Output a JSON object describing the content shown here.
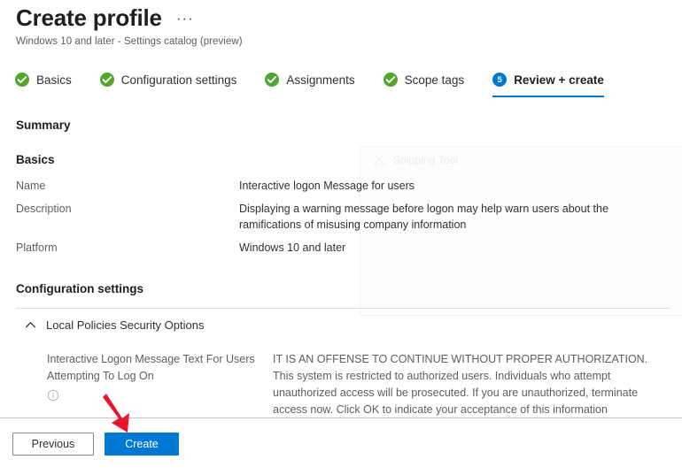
{
  "header": {
    "title": "Create profile",
    "more_menu": "···",
    "subtitle": "Windows 10 and later - Settings catalog (preview)"
  },
  "wizard": {
    "tabs": [
      {
        "label": "Basics",
        "state": "done",
        "badge": "✓"
      },
      {
        "label": "Configuration settings",
        "state": "done",
        "badge": "✓"
      },
      {
        "label": "Assignments",
        "state": "done",
        "badge": "✓"
      },
      {
        "label": "Scope tags",
        "state": "done",
        "badge": "✓"
      },
      {
        "label": "Review + create",
        "state": "current",
        "badge": "5"
      }
    ]
  },
  "summary": {
    "heading": "Summary"
  },
  "basics": {
    "heading": "Basics",
    "rows": [
      {
        "key": "Name",
        "value": "Interactive logon Message for users"
      },
      {
        "key": "Description",
        "value": "Displaying a warning message before logon may help warn users about the ramifications of misusing company information"
      },
      {
        "key": "Platform",
        "value": "Windows 10 and later"
      }
    ]
  },
  "configuration": {
    "heading": "Configuration settings",
    "group": {
      "label": "Local Policies Security Options",
      "expanded": true,
      "chevron_icon": "chevron-up-icon"
    },
    "settings": [
      {
        "name": "Interactive Logon Message Text For Users Attempting To Log On",
        "info_icon": "info-icon",
        "value": "IT IS AN OFFENSE TO CONTINUE WITHOUT PROPER AUTHORIZATION. This system is restricted to authorized users. Individuals who attempt unauthorized access will be prosecuted. If you are unauthorized, terminate access now. Click OK to indicate your acceptance of this information"
      }
    ]
  },
  "footer": {
    "previous_label": "Previous",
    "create_label": "Create"
  },
  "ghost_window": {
    "title": "Snipping Tool",
    "icon": "scissors-icon"
  },
  "colors": {
    "accent_blue": "#0078d4",
    "success_green": "#4fa72c",
    "annotation_red": "#e8152a",
    "divider": "#e1dfdd",
    "text_primary": "#323130",
    "text_secondary": "#605e5c"
  }
}
